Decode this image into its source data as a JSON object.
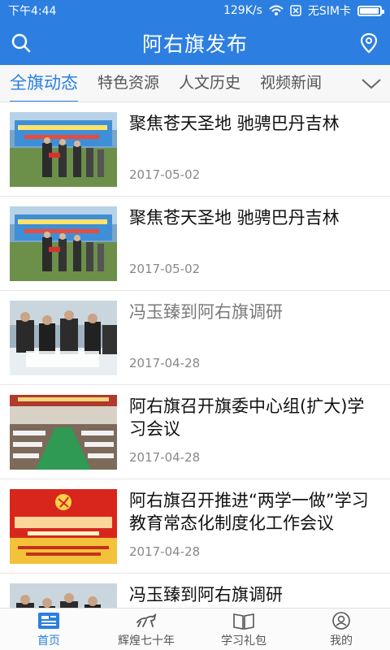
{
  "status_bar": {
    "time": "下午4:44",
    "network_speed": "129K/s",
    "sim_text": "无SIM卡",
    "battery_level_percent": 95
  },
  "header": {
    "title": "阿右旗发布",
    "left_icon": "search-icon",
    "right_icon": "location-pin-icon"
  },
  "tabs": [
    {
      "label": "全旗动态",
      "active": true
    },
    {
      "label": "特色资源",
      "active": false
    },
    {
      "label": "人文历史",
      "active": false
    },
    {
      "label": "视频新闻",
      "active": false
    }
  ],
  "news": [
    {
      "title": "聚焦苍天圣地 驰骋巴丹吉林",
      "date": "2017-05-02",
      "read": false,
      "thumb": "ceremony-stage"
    },
    {
      "title": "聚焦苍天圣地 驰骋巴丹吉林",
      "date": "2017-05-02",
      "read": false,
      "thumb": "ceremony-stage"
    },
    {
      "title": "冯玉臻到阿右旗调研",
      "date": "2017-04-28",
      "read": true,
      "thumb": "officials-map"
    },
    {
      "title": "阿右旗召开旗委中心组(扩大)学习会议",
      "date": "2017-04-28",
      "read": false,
      "thumb": "meeting-hall"
    },
    {
      "title": "阿右旗召开推进“两学一做”学习教育常态化制度化工作会议",
      "date": "2017-04-28",
      "read": false,
      "thumb": "party-banner"
    },
    {
      "title": "冯玉臻到阿右旗调研",
      "date": "",
      "read": false,
      "thumb": "officials-map"
    }
  ],
  "bottom_nav": [
    {
      "label": "首页",
      "icon": "home-news-icon",
      "active": true
    },
    {
      "label": "辉煌七十年",
      "icon": "horse-icon",
      "active": false
    },
    {
      "label": "学习礼包",
      "icon": "book-icon",
      "active": false
    },
    {
      "label": "我的",
      "icon": "profile-icon",
      "active": false
    }
  ],
  "colors": {
    "primary": "#2c7fe0",
    "tab_bar_bg": "#f7f7f7",
    "read_title": "#7a7a7a"
  }
}
